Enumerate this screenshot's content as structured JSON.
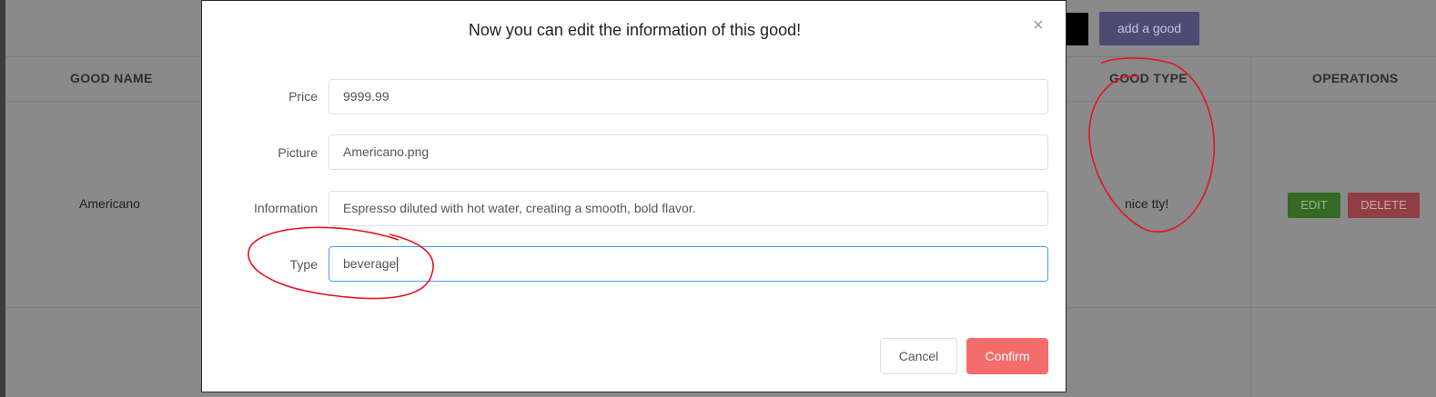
{
  "background": {
    "header_buttons": {
      "partial_label": "n",
      "add_label": "add a good"
    },
    "table": {
      "columns": {
        "name": "GOOD NAME",
        "type": "GOOD TYPE",
        "operations": "OPERATIONS"
      },
      "row": {
        "name": "Americano",
        "type": "nice tty!",
        "edit_label": "EDIT",
        "delete_label": "DELETE"
      }
    }
  },
  "dialog": {
    "title": "Now you can edit the information of this good!",
    "close_glyph": "×",
    "fields": {
      "price": {
        "label": "Price",
        "value": "9999.99"
      },
      "picture": {
        "label": "Picture",
        "value": "Americano.png"
      },
      "information": {
        "label": "Information",
        "value": "Espresso diluted with hot water, creating a smooth, bold flavor."
      },
      "type": {
        "label": "Type",
        "value": "beverage"
      }
    },
    "cancel_label": "Cancel",
    "confirm_label": "Confirm"
  },
  "colors": {
    "overlay": "#8a8a8a",
    "confirm": "#f56c6c",
    "focus_border": "#409eff",
    "annotation": "#e8121d"
  }
}
